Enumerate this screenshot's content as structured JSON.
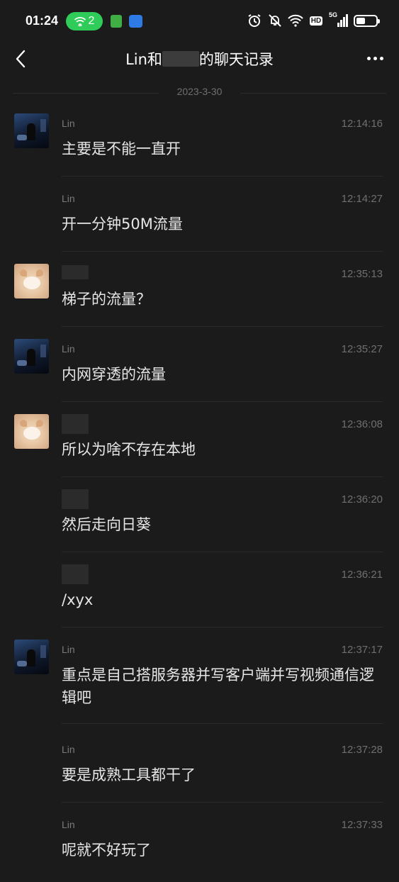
{
  "status_bar": {
    "time": "01:24",
    "hotspot_count": "2",
    "hd_label": "HD",
    "network_label": "5G",
    "icons": [
      "hotspot-icon",
      "app-icon",
      "app-icon",
      "alarm-icon",
      "mute-icon",
      "wifi-icon",
      "hd-icon",
      "signal-icon",
      "battery-icon"
    ],
    "battery_level": 0.45
  },
  "header": {
    "title_prefix": "Lin和",
    "title_suffix": "的聊天记录"
  },
  "date": "2023-3-30",
  "messages": [
    {
      "sender": "Lin",
      "time": "12:14:16",
      "text": "主要是不能一直开",
      "avatar": "lin",
      "show_avatar": true
    },
    {
      "sender": "Lin",
      "time": "12:14:27",
      "text": "开一分钟50M流量",
      "avatar": "lin",
      "show_avatar": false
    },
    {
      "sender": "",
      "time": "12:35:13",
      "text": "梯子的流量？",
      "avatar": "cat",
      "show_avatar": true
    },
    {
      "sender": "Lin",
      "time": "12:35:27",
      "text": "内网穿透的流量",
      "avatar": "lin",
      "show_avatar": true
    },
    {
      "sender": "",
      "time": "12:36:08",
      "text": "所以为啥不存在本地",
      "avatar": "cat",
      "show_avatar": true
    },
    {
      "sender": "",
      "time": "12:36:20",
      "text": "然后走向日葵",
      "avatar": "cat",
      "show_avatar": false
    },
    {
      "sender": "",
      "time": "12:36:21",
      "text": "/xyx",
      "avatar": "cat",
      "show_avatar": false
    },
    {
      "sender": "Lin",
      "time": "12:37:17",
      "text": "重点是自己搭服务器并写客户端并写视频通信逻辑吧",
      "avatar": "lin",
      "show_avatar": true
    },
    {
      "sender": "Lin",
      "time": "12:37:28",
      "text": "要是成熟工具都干了",
      "avatar": "lin",
      "show_avatar": false
    },
    {
      "sender": "Lin",
      "time": "12:37:33",
      "text": "呢就不好玩了",
      "avatar": "lin",
      "show_avatar": false
    }
  ],
  "colors": {
    "background": "#1b1b1b",
    "text": "#e6e6e6",
    "muted": "#6f6f6f",
    "hotspot": "#2fcc5a"
  }
}
